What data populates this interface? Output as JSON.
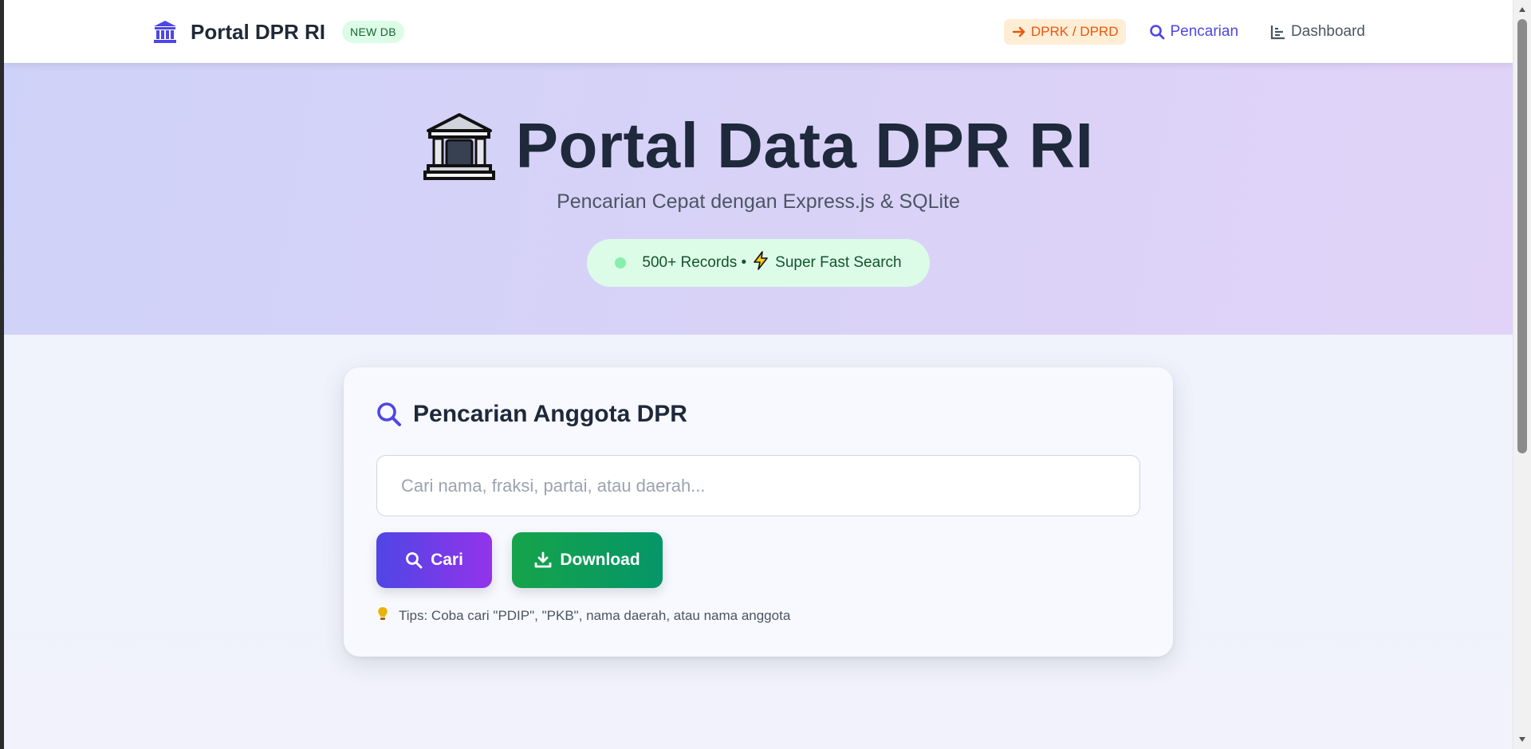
{
  "navbar": {
    "brand_icon": "bank-icon",
    "brand_title": "Portal DPR RI",
    "badge": "NEW DB",
    "links": [
      {
        "label": "DPRK / DPRD",
        "icon": "arrow-right-icon"
      },
      {
        "label": "Pencarian",
        "icon": "search-icon"
      },
      {
        "label": "Dashboard",
        "icon": "chart-icon"
      }
    ]
  },
  "hero": {
    "icon": "classical-building-emoji",
    "title": "Portal Data DPR RI",
    "subtitle": "Pencarian Cepat dengan Express.js & SQLite",
    "status_pill": {
      "records": "500+ Records •",
      "speed": "Super Fast Search"
    }
  },
  "search_card": {
    "title": "Pencarian Anggota DPR",
    "input_value": "",
    "input_placeholder": "Cari nama, fraksi, partai, atau daerah...",
    "search_button": "Cari",
    "download_button": "Download",
    "tips": "Tips: Coba cari \"PDIP\", \"PKB\", nama daerah, atau nama anggota"
  },
  "colors": {
    "accent": "#4f46e5",
    "dprk_link": "#ea580c",
    "success": "#16a34a",
    "title_text": "#1e293b"
  }
}
